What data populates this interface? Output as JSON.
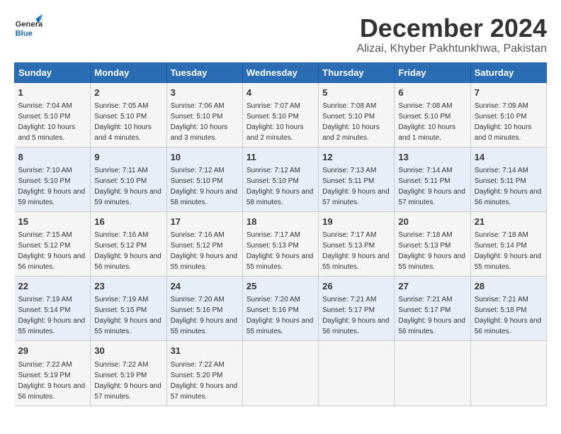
{
  "header": {
    "logo_general": "General",
    "logo_blue": "Blue",
    "month_title": "December 2024",
    "location": "Alizai, Khyber Pakhtunkhwa, Pakistan"
  },
  "weekdays": [
    "Sunday",
    "Monday",
    "Tuesday",
    "Wednesday",
    "Thursday",
    "Friday",
    "Saturday"
  ],
  "weeks": [
    [
      {
        "day": "1",
        "sunrise": "Sunrise: 7:04 AM",
        "sunset": "Sunset: 5:10 PM",
        "daylight": "Daylight: 10 hours and 5 minutes."
      },
      {
        "day": "2",
        "sunrise": "Sunrise: 7:05 AM",
        "sunset": "Sunset: 5:10 PM",
        "daylight": "Daylight: 10 hours and 4 minutes."
      },
      {
        "day": "3",
        "sunrise": "Sunrise: 7:06 AM",
        "sunset": "Sunset: 5:10 PM",
        "daylight": "Daylight: 10 hours and 3 minutes."
      },
      {
        "day": "4",
        "sunrise": "Sunrise: 7:07 AM",
        "sunset": "Sunset: 5:10 PM",
        "daylight": "Daylight: 10 hours and 2 minutes."
      },
      {
        "day": "5",
        "sunrise": "Sunrise: 7:08 AM",
        "sunset": "Sunset: 5:10 PM",
        "daylight": "Daylight: 10 hours and 2 minutes."
      },
      {
        "day": "6",
        "sunrise": "Sunrise: 7:08 AM",
        "sunset": "Sunset: 5:10 PM",
        "daylight": "Daylight: 10 hours and 1 minute."
      },
      {
        "day": "7",
        "sunrise": "Sunrise: 7:09 AM",
        "sunset": "Sunset: 5:10 PM",
        "daylight": "Daylight: 10 hours and 0 minutes."
      }
    ],
    [
      {
        "day": "8",
        "sunrise": "Sunrise: 7:10 AM",
        "sunset": "Sunset: 5:10 PM",
        "daylight": "Daylight: 9 hours and 59 minutes."
      },
      {
        "day": "9",
        "sunrise": "Sunrise: 7:11 AM",
        "sunset": "Sunset: 5:10 PM",
        "daylight": "Daylight: 9 hours and 59 minutes."
      },
      {
        "day": "10",
        "sunrise": "Sunrise: 7:12 AM",
        "sunset": "Sunset: 5:10 PM",
        "daylight": "Daylight: 9 hours and 58 minutes."
      },
      {
        "day": "11",
        "sunrise": "Sunrise: 7:12 AM",
        "sunset": "Sunset: 5:10 PM",
        "daylight": "Daylight: 9 hours and 58 minutes."
      },
      {
        "day": "12",
        "sunrise": "Sunrise: 7:13 AM",
        "sunset": "Sunset: 5:11 PM",
        "daylight": "Daylight: 9 hours and 57 minutes."
      },
      {
        "day": "13",
        "sunrise": "Sunrise: 7:14 AM",
        "sunset": "Sunset: 5:11 PM",
        "daylight": "Daylight: 9 hours and 57 minutes."
      },
      {
        "day": "14",
        "sunrise": "Sunrise: 7:14 AM",
        "sunset": "Sunset: 5:11 PM",
        "daylight": "Daylight: 9 hours and 56 minutes."
      }
    ],
    [
      {
        "day": "15",
        "sunrise": "Sunrise: 7:15 AM",
        "sunset": "Sunset: 5:12 PM",
        "daylight": "Daylight: 9 hours and 56 minutes."
      },
      {
        "day": "16",
        "sunrise": "Sunrise: 7:16 AM",
        "sunset": "Sunset: 5:12 PM",
        "daylight": "Daylight: 9 hours and 56 minutes."
      },
      {
        "day": "17",
        "sunrise": "Sunrise: 7:16 AM",
        "sunset": "Sunset: 5:12 PM",
        "daylight": "Daylight: 9 hours and 55 minutes."
      },
      {
        "day": "18",
        "sunrise": "Sunrise: 7:17 AM",
        "sunset": "Sunset: 5:13 PM",
        "daylight": "Daylight: 9 hours and 55 minutes."
      },
      {
        "day": "19",
        "sunrise": "Sunrise: 7:17 AM",
        "sunset": "Sunset: 5:13 PM",
        "daylight": "Daylight: 9 hours and 55 minutes."
      },
      {
        "day": "20",
        "sunrise": "Sunrise: 7:18 AM",
        "sunset": "Sunset: 5:13 PM",
        "daylight": "Daylight: 9 hours and 55 minutes."
      },
      {
        "day": "21",
        "sunrise": "Sunrise: 7:18 AM",
        "sunset": "Sunset: 5:14 PM",
        "daylight": "Daylight: 9 hours and 55 minutes."
      }
    ],
    [
      {
        "day": "22",
        "sunrise": "Sunrise: 7:19 AM",
        "sunset": "Sunset: 5:14 PM",
        "daylight": "Daylight: 9 hours and 55 minutes."
      },
      {
        "day": "23",
        "sunrise": "Sunrise: 7:19 AM",
        "sunset": "Sunset: 5:15 PM",
        "daylight": "Daylight: 9 hours and 55 minutes."
      },
      {
        "day": "24",
        "sunrise": "Sunrise: 7:20 AM",
        "sunset": "Sunset: 5:16 PM",
        "daylight": "Daylight: 9 hours and 55 minutes."
      },
      {
        "day": "25",
        "sunrise": "Sunrise: 7:20 AM",
        "sunset": "Sunset: 5:16 PM",
        "daylight": "Daylight: 9 hours and 55 minutes."
      },
      {
        "day": "26",
        "sunrise": "Sunrise: 7:21 AM",
        "sunset": "Sunset: 5:17 PM",
        "daylight": "Daylight: 9 hours and 56 minutes."
      },
      {
        "day": "27",
        "sunrise": "Sunrise: 7:21 AM",
        "sunset": "Sunset: 5:17 PM",
        "daylight": "Daylight: 9 hours and 56 minutes."
      },
      {
        "day": "28",
        "sunrise": "Sunrise: 7:21 AM",
        "sunset": "Sunset: 5:18 PM",
        "daylight": "Daylight: 9 hours and 56 minutes."
      }
    ],
    [
      {
        "day": "29",
        "sunrise": "Sunrise: 7:22 AM",
        "sunset": "Sunset: 5:19 PM",
        "daylight": "Daylight: 9 hours and 56 minutes."
      },
      {
        "day": "30",
        "sunrise": "Sunrise: 7:22 AM",
        "sunset": "Sunset: 5:19 PM",
        "daylight": "Daylight: 9 hours and 57 minutes."
      },
      {
        "day": "31",
        "sunrise": "Sunrise: 7:22 AM",
        "sunset": "Sunset: 5:20 PM",
        "daylight": "Daylight: 9 hours and 57 minutes."
      },
      null,
      null,
      null,
      null
    ]
  ]
}
